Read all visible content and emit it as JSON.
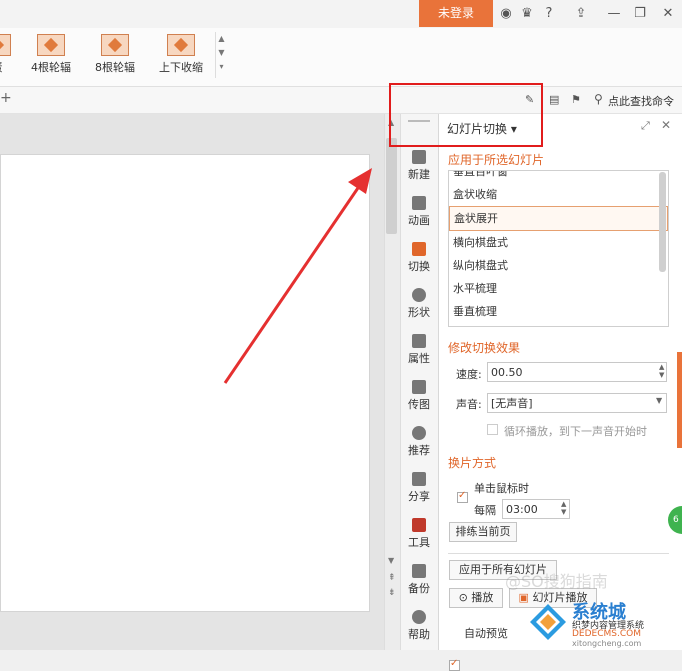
{
  "titlebar": {
    "login_label": "未登录",
    "icons": [
      "shield-icon",
      "shirt-icon",
      "help-icon",
      "upload-icon",
      "minimize-icon",
      "restore-icon",
      "close-icon"
    ],
    "help_label": "?"
  },
  "ribbon": {
    "gallery": [
      {
        "label": "蛋"
      },
      {
        "label": "4根轮辐"
      },
      {
        "label": "8根轮辐"
      },
      {
        "label": "上下收缩"
      }
    ],
    "row2": {
      "plus": "+",
      "search_label": "点此查找命令"
    }
  },
  "sidebar": {
    "tabs": [
      {
        "label": "新建",
        "icon": "new-icon"
      },
      {
        "label": "动画",
        "icon": "animation-icon"
      },
      {
        "label": "切换",
        "icon": "transition-icon"
      },
      {
        "label": "形状",
        "icon": "shape-icon"
      },
      {
        "label": "属性",
        "icon": "properties-icon"
      },
      {
        "label": "传图",
        "icon": "upload-image-icon"
      },
      {
        "label": "推荐",
        "icon": "recommend-icon"
      },
      {
        "label": "分享",
        "icon": "share-icon"
      },
      {
        "label": "工具",
        "icon": "toolbox-icon"
      },
      {
        "label": "备份",
        "icon": "backup-icon"
      },
      {
        "label": "帮助",
        "icon": "help-icon"
      }
    ]
  },
  "pane": {
    "title": "幻灯片切换",
    "apply_title": "应用于所选幻灯片",
    "effects": [
      "垂直百叶窗",
      "盒状收缩",
      "盒状展开",
      "横向棋盘式",
      "纵向棋盘式",
      "水平梳理",
      "垂直梳理"
    ],
    "selected_effect": "盒状展开",
    "modify_title": "修改切换效果",
    "speed_label": "速度:",
    "speed_value": "00.50",
    "sound_label": "声音:",
    "sound_value": "[无声音]",
    "loop_label": "循环播放，到下一声音开始时",
    "advance_title": "换片方式",
    "on_click_label": "单击鼠标时",
    "every_label": "每隔",
    "every_value": "03:00",
    "rehearse_label": "排练当前页",
    "apply_all_label": "应用于所有幻灯片",
    "play_label": "播放",
    "slideshow_label": "幻灯片播放",
    "auto_preview_label": "自动预览"
  },
  "watermark": {
    "brand": "系统城",
    "subtitle": "织梦内容管理系统",
    "url1": "DEDECMS.COM",
    "url2": "xitongcheng.com",
    "ghost": "@SO搜狗指南"
  },
  "badge": "6"
}
